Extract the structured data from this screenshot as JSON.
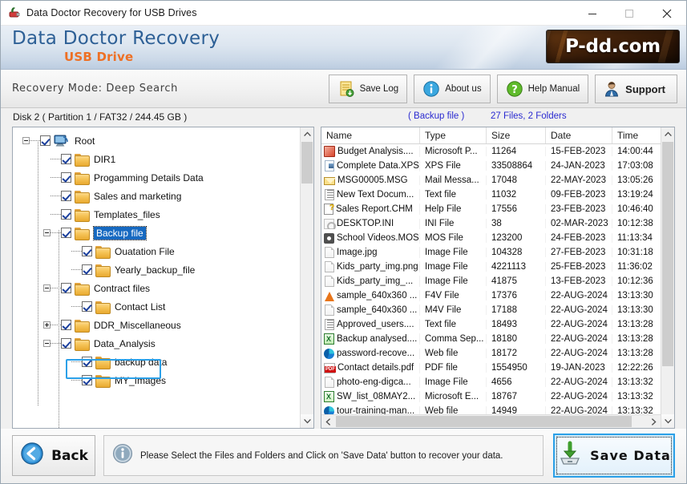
{
  "window": {
    "title": "Data Doctor Recovery for USB Drives",
    "icon": "usb-drive-icon",
    "minimize": "minimize-icon",
    "maximize": "maximize-icon",
    "close": "close-icon"
  },
  "banner": {
    "brand_line1": "Data Doctor Recovery",
    "brand_line2": "USB Drive",
    "logo_text": "P-dd.com"
  },
  "toolbar": {
    "mode_text": "Recovery Mode: Deep Search",
    "buttons": [
      {
        "label": "Save Log",
        "icon": "save-log-icon"
      },
      {
        "label": "About us",
        "icon": "info-icon"
      },
      {
        "label": "Help Manual",
        "icon": "question-icon"
      },
      {
        "label": "Support",
        "icon": "support-person-icon"
      }
    ]
  },
  "info": {
    "disk_label": "Disk 2 ( Partition 1 / FAT32 / 244.45 GB )",
    "backup_label": "( Backup file )",
    "files_label": "27 Files, 2 Folders"
  },
  "tree": {
    "nodes": [
      {
        "label": "Root",
        "depth": 0,
        "expander": "minus",
        "checked": true,
        "icon": "disk-icon",
        "selected": false
      },
      {
        "label": "DIR1",
        "depth": 1,
        "expander": "none",
        "checked": true,
        "icon": "folder-icon",
        "selected": false
      },
      {
        "label": "Progamming Details Data",
        "depth": 1,
        "expander": "none",
        "checked": true,
        "icon": "folder-icon",
        "selected": false
      },
      {
        "label": "Sales and marketing",
        "depth": 1,
        "expander": "none",
        "checked": true,
        "icon": "folder-icon",
        "selected": false
      },
      {
        "label": "Templates_files",
        "depth": 1,
        "expander": "none",
        "checked": true,
        "icon": "folder-icon",
        "selected": false
      },
      {
        "label": "Backup file",
        "depth": 1,
        "expander": "minus",
        "checked": true,
        "icon": "folder-icon",
        "selected": true
      },
      {
        "label": "Ouatation File",
        "depth": 2,
        "expander": "none",
        "checked": true,
        "icon": "folder-icon",
        "selected": false
      },
      {
        "label": "Yearly_backup_file",
        "depth": 2,
        "expander": "none",
        "checked": true,
        "icon": "folder-icon",
        "selected": false
      },
      {
        "label": "Contract files",
        "depth": 1,
        "expander": "minus",
        "checked": true,
        "icon": "folder-icon",
        "selected": false
      },
      {
        "label": "Contact List",
        "depth": 2,
        "expander": "none",
        "checked": true,
        "icon": "folder-icon",
        "selected": false
      },
      {
        "label": "DDR_Miscellaneous",
        "depth": 1,
        "expander": "plus",
        "checked": true,
        "icon": "folder-icon",
        "selected": false
      },
      {
        "label": "Data_Analysis",
        "depth": 1,
        "expander": "minus",
        "checked": true,
        "icon": "folder-icon",
        "selected": false
      },
      {
        "label": "backup data",
        "depth": 2,
        "expander": "none",
        "checked": true,
        "icon": "folder-icon",
        "selected": false
      },
      {
        "label": "MY_Images",
        "depth": 2,
        "expander": "none",
        "checked": true,
        "icon": "folder-icon",
        "selected": false
      }
    ]
  },
  "filelist": {
    "columns": [
      "Name",
      "Type",
      "Size",
      "Date",
      "Time"
    ],
    "rows": [
      {
        "name": "Budget Analysis....",
        "icon": "powerpoint-file-icon",
        "type": "Microsoft P...",
        "size": "11264",
        "date": "15-FEB-2023",
        "time": "14:00:44"
      },
      {
        "name": "Complete Data.XPS",
        "icon": "xps-file-icon",
        "type": "XPS File",
        "size": "33508864",
        "date": "24-JAN-2023",
        "time": "17:03:08"
      },
      {
        "name": "MSG00005.MSG",
        "icon": "mail-file-icon",
        "type": "Mail Messa...",
        "size": "17048",
        "date": "22-MAY-2023",
        "time": "13:05:26"
      },
      {
        "name": "New Text Docum...",
        "icon": "text-file-icon",
        "type": "Text file",
        "size": "11032",
        "date": "09-FEB-2023",
        "time": "13:19:24"
      },
      {
        "name": "Sales Report.CHM",
        "icon": "help-file-icon",
        "type": "Help File",
        "size": "17556",
        "date": "23-FEB-2023",
        "time": "10:46:40"
      },
      {
        "name": "DESKTOP.INI",
        "icon": "ini-file-icon",
        "type": "INI File",
        "size": "38",
        "date": "02-MAR-2023",
        "time": "10:12:38"
      },
      {
        "name": "School Videos.MOS",
        "icon": "mos-file-icon",
        "type": "MOS File",
        "size": "123200",
        "date": "24-FEB-2023",
        "time": "11:13:34"
      },
      {
        "name": "Image.jpg",
        "icon": "generic-file-icon",
        "type": "Image File",
        "size": "104328",
        "date": "27-FEB-2023",
        "time": "10:31:18"
      },
      {
        "name": "Kids_party_img.png",
        "icon": "generic-file-icon",
        "type": "Image File",
        "size": "4221113",
        "date": "25-FEB-2023",
        "time": "11:36:02"
      },
      {
        "name": "Kids_party_img_...",
        "icon": "generic-file-icon",
        "type": "Image File",
        "size": "41875",
        "date": "13-FEB-2023",
        "time": "10:12:36"
      },
      {
        "name": "sample_640x360 ...",
        "icon": "vlc-file-icon",
        "type": "F4V File",
        "size": "17376",
        "date": "22-AUG-2024",
        "time": "13:13:30"
      },
      {
        "name": "sample_640x360 ...",
        "icon": "generic-file-icon",
        "type": "M4V File",
        "size": "17188",
        "date": "22-AUG-2024",
        "time": "13:13:30"
      },
      {
        "name": "Approved_users....",
        "icon": "text-file-icon",
        "type": "Text file",
        "size": "18493",
        "date": "22-AUG-2024",
        "time": "13:13:28"
      },
      {
        "name": "Backup analysed....",
        "icon": "csv-file-icon",
        "type": "Comma Sep...",
        "size": "18180",
        "date": "22-AUG-2024",
        "time": "13:13:28"
      },
      {
        "name": "password-recove...",
        "icon": "web-file-icon",
        "type": "Web file",
        "size": "18172",
        "date": "22-AUG-2024",
        "time": "13:13:28"
      },
      {
        "name": "Contact details.pdf",
        "icon": "pdf-file-icon",
        "type": "PDF file",
        "size": "1554950",
        "date": "19-JAN-2023",
        "time": "12:22:26"
      },
      {
        "name": "photo-eng-digca...",
        "icon": "generic-file-icon",
        "type": "Image File",
        "size": "4656",
        "date": "22-AUG-2024",
        "time": "13:13:32"
      },
      {
        "name": "SW_list_08MAY2...",
        "icon": "excel-file-icon",
        "type": "Microsoft E...",
        "size": "18767",
        "date": "22-AUG-2024",
        "time": "13:13:32"
      },
      {
        "name": "tour-training-man...",
        "icon": "web-file-icon",
        "type": "Web file",
        "size": "14949",
        "date": "22-AUG-2024",
        "time": "13:13:32"
      }
    ]
  },
  "bottom": {
    "back_label": "Back",
    "back_icon": "back-arrow-icon",
    "status_icon": "info-icon",
    "status_text": "Please Select the Files and Folders and Click on 'Save Data' button to recover your data.",
    "save_label": "Save  Data",
    "save_icon": "save-data-icon"
  },
  "colors": {
    "accent_blue": "#2ba0e8",
    "brand_blue": "#2e6096",
    "brand_orange": "#ee7024",
    "link_blue": "#2a2ad0",
    "selection_blue": "#1669c1"
  }
}
